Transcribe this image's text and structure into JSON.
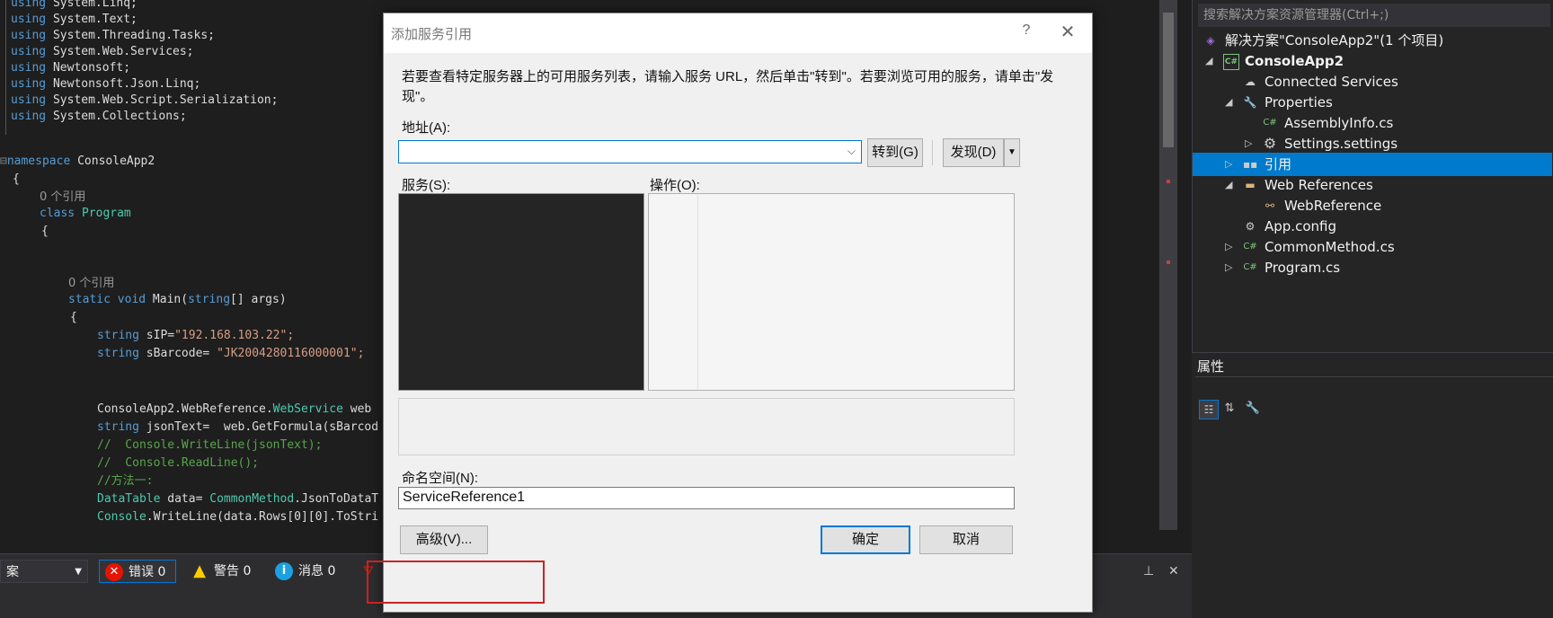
{
  "editor": {
    "using_lines": [
      {
        "kw": "using",
        "ns": "System.Linq;"
      },
      {
        "kw": "using",
        "ns": "System.Text;"
      },
      {
        "kw": "using",
        "ns": "System.Threading.Tasks;"
      },
      {
        "kw": "using",
        "ns": "System.Web.Services;"
      },
      {
        "kw": "using",
        "ns": "Newtonsoft;"
      },
      {
        "kw": "using",
        "ns": "Newtonsoft.Json.Linq;"
      },
      {
        "kw": "using",
        "ns": "System.Web.Script.Serialization;"
      },
      {
        "kw": "using",
        "ns": "System.Collections;"
      }
    ],
    "namespace_kw": "namespace",
    "namespace_name": "ConsoleApp2",
    "open_brace": "{",
    "ref_count_1": "0 个引用",
    "class_kw": "class",
    "class_name": "Program",
    "ref_count_2": "0 个引用",
    "main_sig_kw": "static void",
    "main_sig_rest": "Main(",
    "main_sig_type": "string",
    "main_sig_end": "[] args)",
    "line_sip_kw": "string",
    "line_sip_rest": "sIP=",
    "line_sip_str": "\"192.168.103.22\";",
    "line_sbar_kw": "string",
    "line_sbar_rest": "sBarcode= ",
    "line_sbar_str": "\"JK2004280116000001\";",
    "line_ws_a": "ConsoleApp2.WebReference.",
    "line_ws_type": "WebService",
    "line_ws_b": " web",
    "line_json_kw": "string",
    "line_json_rest": "jsonText=  web.GetFormula(sBarcod",
    "line_c1": "//  Console.WriteLine(jsonText);",
    "line_c2": "//  Console.ReadLine();",
    "line_c3": "//方法一:",
    "line_dt_type": "DataTable",
    "line_dt_rest": " data= ",
    "line_dt_type2": "CommonMethod",
    "line_dt_end": ".JsonToDataT",
    "line_cw_type": "Console",
    "line_cw_rest": ".WriteLine(data.Rows[0][0].ToStri"
  },
  "error_list": {
    "scope_text": "案",
    "errors_label": "错误 0",
    "warnings_label": "警告 0",
    "messages_label": "消息 0"
  },
  "solution_explorer": {
    "search_placeholder": "搜索解决方案资源管理器(Ctrl+;)",
    "items": [
      {
        "label": "解决方案\"ConsoleApp2\"(1 个项目)"
      },
      {
        "label": "ConsoleApp2"
      },
      {
        "label": "Connected Services"
      },
      {
        "label": "Properties"
      },
      {
        "label": "AssemblyInfo.cs"
      },
      {
        "label": "Settings.settings"
      },
      {
        "label": "引用"
      },
      {
        "label": "Web References"
      },
      {
        "label": "WebReference"
      },
      {
        "label": "App.config"
      },
      {
        "label": "CommonMethod.cs"
      },
      {
        "label": "Program.cs"
      }
    ]
  },
  "properties": {
    "title": "属性"
  },
  "dialog": {
    "title": "添加服务引用",
    "help": "?",
    "close": "✕",
    "description": "若要查看特定服务器上的可用服务列表，请输入服务 URL，然后单击\"转到\"。若要浏览可用的服务，请单击\"发现\"。",
    "address_label": "地址(A):",
    "address_value": "",
    "go_button": "转到(G)",
    "discover_button": "发现(D)",
    "services_label": "服务(S):",
    "operations_label": "操作(O):",
    "namespace_label": "命名空间(N):",
    "namespace_value": "ServiceReference1",
    "advanced_button": "高级(V)...",
    "ok_button": "确定",
    "cancel_button": "取消"
  },
  "colors": {
    "accent": "#007acc",
    "dialog_bg": "#f0f0f0",
    "highlight": "#cc2222"
  }
}
